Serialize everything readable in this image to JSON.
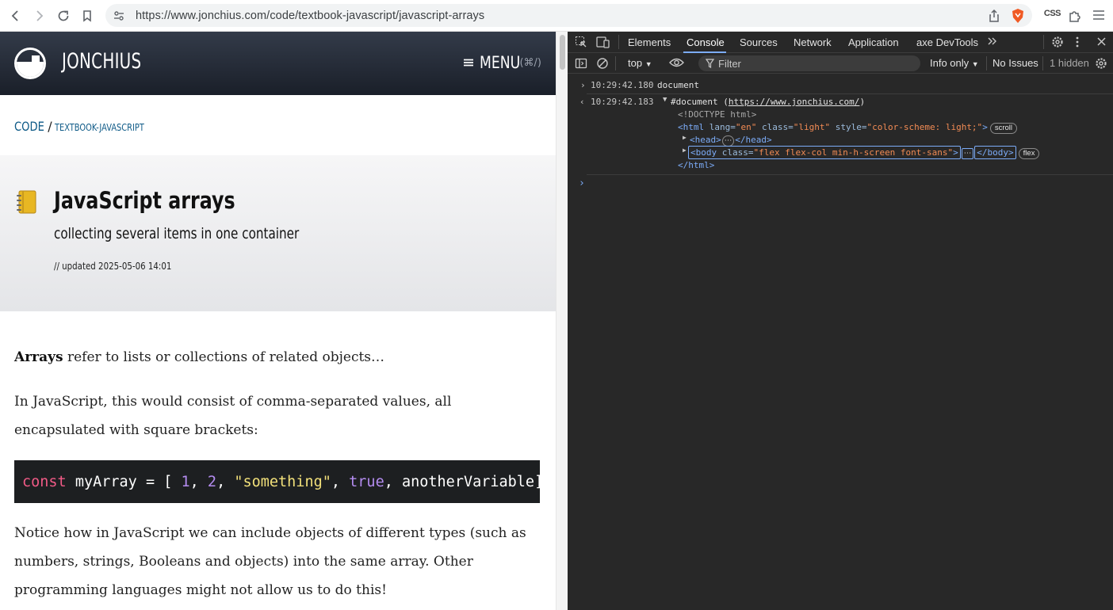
{
  "browser": {
    "url": "https://www.jonchius.com/code/textbook-javascript/javascript-arrays",
    "ext_css": "CSS"
  },
  "site": {
    "name": "JONCHIUS",
    "menu_label": "MENU",
    "menu_shortcut": "(⌘/)"
  },
  "breadcrumb": {
    "main": "CODE",
    "separator": "/",
    "sub": "TEXTBOOK-JAVASCRIPT"
  },
  "hero": {
    "title": "JavaScript arrays",
    "subtitle": "collecting several items in one container",
    "updated": "// updated 2025-05-06 14:01"
  },
  "article": {
    "p1_bold": "Arrays",
    "p1_rest": " refer to lists or collections of related objects…",
    "p2": "In JavaScript, this would consist of comma-separated values, all encapsulated with square brackets:",
    "code": {
      "kw": "const",
      "t1": " myArray = [ ",
      "n1": "1",
      "t2": ", ",
      "n2": "2",
      "t3": ", ",
      "s1": "\"something\"",
      "t4": ", ",
      "b1": "true",
      "t5": ", anotherVariable]"
    },
    "p3": "Notice how in JavaScript we can include objects of different types (such as numbers, strings, Booleans and objects) into the same array. Other programming languages might not allow us to do this!"
  },
  "devtools": {
    "tabs": [
      "Elements",
      "Console",
      "Sources",
      "Network",
      "Application",
      "axe DevTools"
    ],
    "active_tab": "Console",
    "context": "top",
    "filter_placeholder": "Filter",
    "levels": "Info only",
    "issues": "No Issues",
    "hidden": "1 hidden",
    "console": {
      "l1_ts": "10:29:42.180",
      "l1_text": "document",
      "l2_ts": "10:29:42.183",
      "l2_prefix": "#document (",
      "l2_link": "https://www.jonchius.com/",
      "l2_suffix": ")",
      "doctype": "<!DOCTYPE html>",
      "html_open": "<html",
      "html_lang_attr": "lang=",
      "html_lang_val": "\"en\"",
      "html_class_attr": "class=",
      "html_class_val": "\"light\"",
      "html_style_attr": "style=",
      "html_style_val": "\"color-scheme: light;\"",
      "html_close_bracket": ">",
      "badge_scroll": "scroll",
      "head_open": "<head>",
      "head_close": "</head>",
      "body_open": "<body",
      "body_class_attr": "class=",
      "body_class_val": "\"flex flex-col min-h-screen font-sans\"",
      "body_close_bracket": ">",
      "body_close": "</body>",
      "badge_flex": "flex",
      "html_close": "</html>",
      "ellipsis": "⋯",
      "prompt": "›"
    }
  }
}
